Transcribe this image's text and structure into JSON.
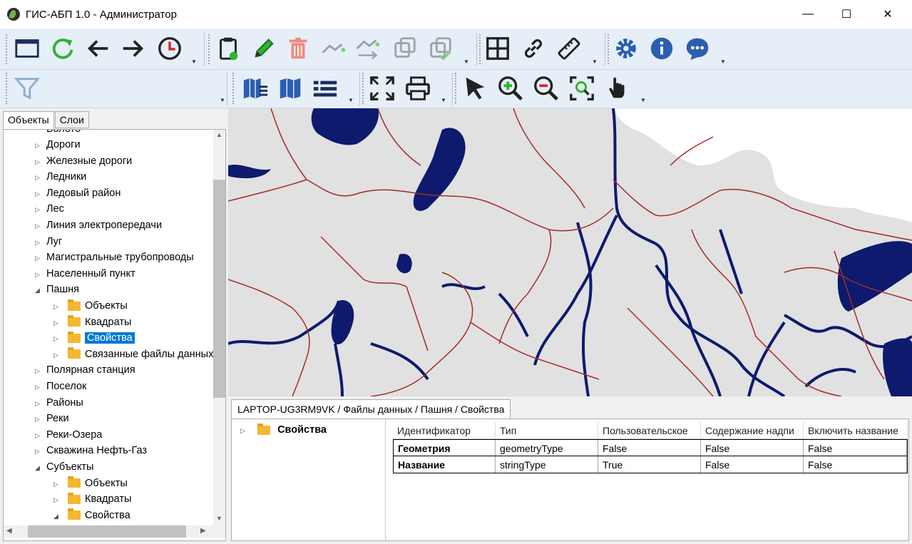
{
  "window": {
    "title": "ГИС-АБП 1.0 - Администратор",
    "minimize": "—",
    "maximize": "☐",
    "close": "✕"
  },
  "toolbar1": {
    "icons": [
      "window-icon",
      "refresh-icon",
      "back-arrow-icon",
      "forward-arrow-icon",
      "clock-icon",
      "clipboard-icon",
      "pencil-icon",
      "trash-icon",
      "line-edit-icon",
      "line-move-icon",
      "copy-icon",
      "copy-check-icon",
      "grid-icon",
      "link-icon",
      "ruler-icon",
      "gear-icon",
      "info-icon",
      "chat-icon"
    ]
  },
  "toolbar2": {
    "icons": [
      "filter-icon",
      "map-layers-icon",
      "map-icon",
      "legend-icon",
      "fullscreen-icon",
      "print-icon",
      "pointer-icon",
      "zoom-in-icon",
      "zoom-out-icon",
      "zoom-extent-icon",
      "pan-hand-icon"
    ]
  },
  "left_tabs": [
    "Объекты",
    "Слои"
  ],
  "tree": {
    "top_cut": "Болото",
    "items": [
      {
        "label": "Дороги",
        "level": 0,
        "expanded": false
      },
      {
        "label": "Железные дороги",
        "level": 0,
        "expanded": false
      },
      {
        "label": "Ледники",
        "level": 0,
        "expanded": false
      },
      {
        "label": "Ледовый район",
        "level": 0,
        "expanded": false
      },
      {
        "label": "Лес",
        "level": 0,
        "expanded": false
      },
      {
        "label": "Линия электропередачи",
        "level": 0,
        "expanded": false
      },
      {
        "label": "Луг",
        "level": 0,
        "expanded": false
      },
      {
        "label": "Магистральные трубопроводы",
        "level": 0,
        "expanded": false
      },
      {
        "label": "Населенный пункт",
        "level": 0,
        "expanded": false
      },
      {
        "label": "Пашня",
        "level": 0,
        "expanded": true
      },
      {
        "label": "Объекты",
        "level": 1,
        "expanded": false
      },
      {
        "label": "Квадраты",
        "level": 1,
        "expanded": false
      },
      {
        "label": "Свойства",
        "level": 1,
        "expanded": false,
        "selected": true
      },
      {
        "label": "Связанные файлы данных",
        "level": 1,
        "expanded": false
      },
      {
        "label": "Полярная станция",
        "level": 0,
        "expanded": false
      },
      {
        "label": "Поселок",
        "level": 0,
        "expanded": false
      },
      {
        "label": "Районы",
        "level": 0,
        "expanded": false
      },
      {
        "label": "Реки",
        "level": 0,
        "expanded": false
      },
      {
        "label": "Реки-Озера",
        "level": 0,
        "expanded": false
      },
      {
        "label": "Скважина Нефть-Газ",
        "level": 0,
        "expanded": false
      },
      {
        "label": "Субъекты",
        "level": 0,
        "expanded": true
      },
      {
        "label": "Объекты",
        "level": 1,
        "expanded": false
      },
      {
        "label": "Квадраты",
        "level": 1,
        "expanded": false
      },
      {
        "label": "Свойства",
        "level": 1,
        "expanded": true
      }
    ]
  },
  "bottom": {
    "path_tab": "LAPTOP-UG3RM9VK / Файлы данных / Пашня / Свойства",
    "node": "Свойства",
    "columns": [
      "Идентификатор",
      "Тип",
      "Пользовательское",
      "Содержание надпи",
      "Включить название"
    ],
    "rows": [
      [
        "Геометрия",
        "geometryType",
        "False",
        "False",
        "False"
      ],
      [
        "Название",
        "stringType",
        "True",
        "False",
        "False"
      ]
    ]
  },
  "colors": {
    "water": "#0d1a6e",
    "land": "#e1e1e1",
    "border": "#a52a2a",
    "selection": "#0078d7",
    "toolbar": "#e6eef8"
  }
}
